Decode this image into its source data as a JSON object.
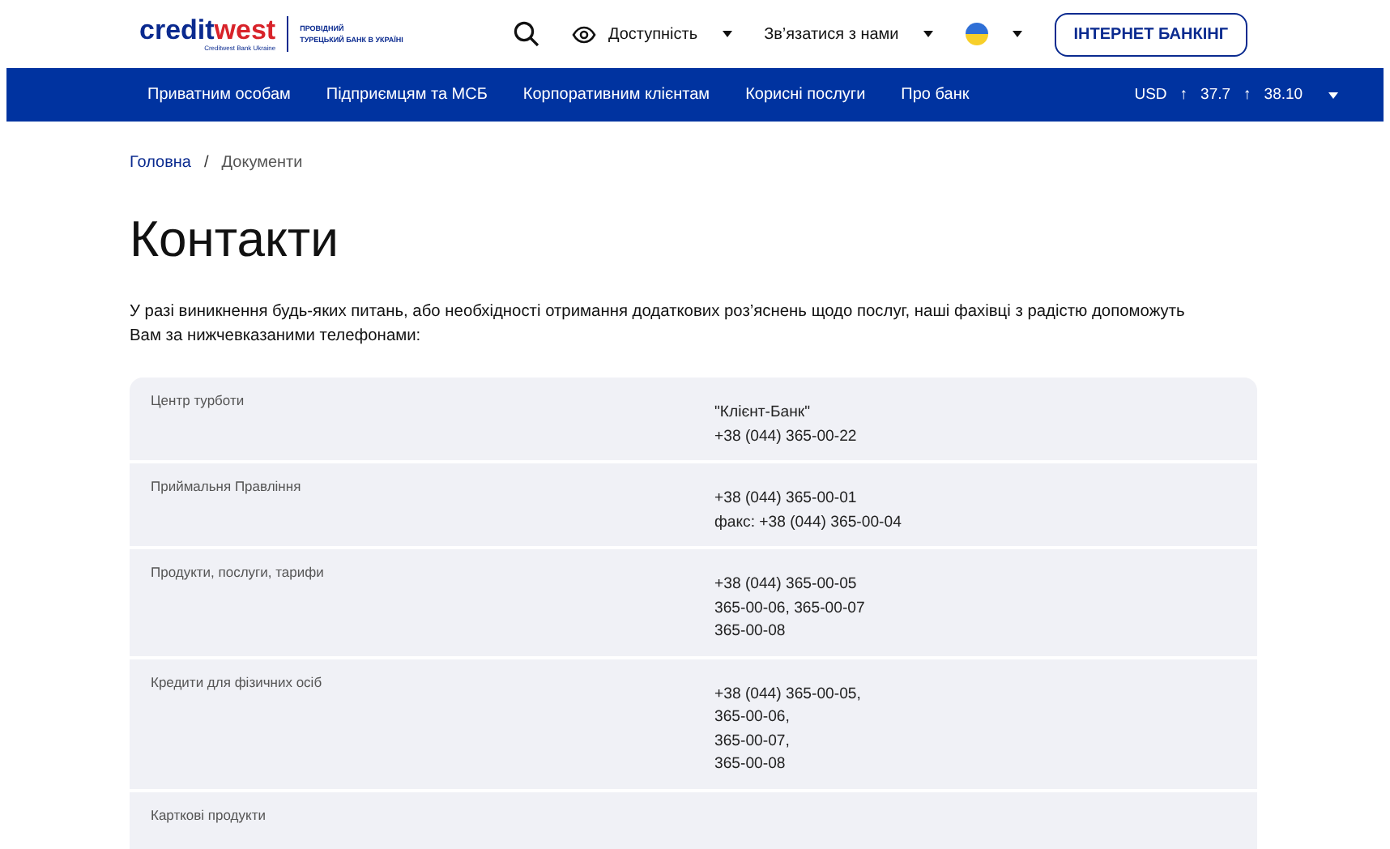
{
  "logo": {
    "brand_start": "credit",
    "brand_end": "west",
    "subtitle": "Creditwest Bank Ukraine",
    "tagline": [
      "ПРОВІДНИЙ",
      "ТУРЕЦЬКИЙ БАНК В УКРАЇНІ"
    ]
  },
  "header": {
    "accessibility": "Доступність",
    "contact": "Зв’язатися з нами",
    "banking_button": "ІНТЕРНЕТ БАНКІНГ"
  },
  "nav": {
    "items": [
      "Приватним особам",
      "Підприємцям та МСБ",
      "Корпоративним клієнтам",
      "Корисні послуги",
      "Про банк"
    ],
    "currency": {
      "code": "USD",
      "buy_arrow": "↑",
      "buy": "37.7",
      "sell_arrow": "↑",
      "sell": "38.10"
    }
  },
  "breadcrumb_separator": "/",
  "breadcrumb": [
    {
      "label": "Головна",
      "link": true
    },
    {
      "label": "Документи",
      "link": false
    }
  ],
  "title": "Контакти",
  "intro": "У разі виникнення будь-яких питань, або необхідності отримання додаткових роз’яснень щодо послуг, наші фахівці з радістю допоможуть Вам за нижчевказаними телефонами:",
  "contacts": [
    {
      "label": "Центр турботи",
      "lines": [
        "\"Клієнт-Банк\"",
        "+38 (044) 365-00-22"
      ]
    },
    {
      "label": "Приймальня  Правління",
      "lines": [
        "+38 (044) 365-00-01",
        "факс: +38 (044) 365-00-04"
      ]
    },
    {
      "label": "Продукти, послуги, тарифи",
      "lines": [
        "+38 (044) 365-00-05",
        "365-00-06, 365-00-07",
        "365-00-08"
      ]
    },
    {
      "label": "Кредити для фізичних осіб",
      "lines": [
        "+38 (044) 365-00-05,",
        "365-00-06,",
        "365-00-07,",
        "365-00-08"
      ]
    },
    {
      "label": "Карткові продукти"
    }
  ]
}
